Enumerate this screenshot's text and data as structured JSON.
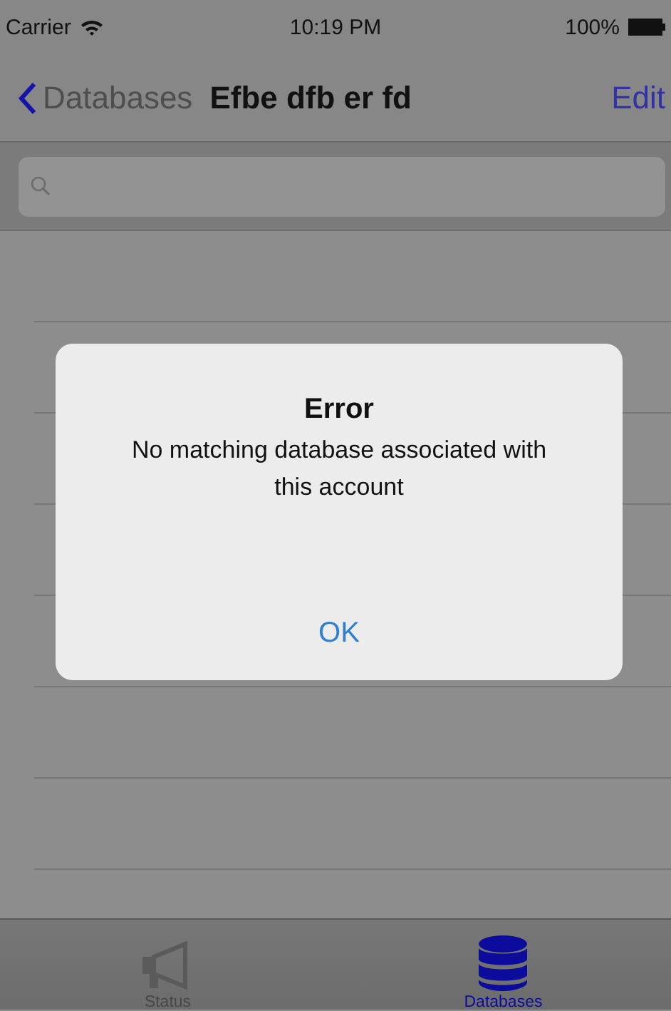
{
  "status_bar": {
    "carrier": "Carrier",
    "time": "10:19 PM",
    "battery": "100%"
  },
  "nav_bar": {
    "back": "Databases",
    "title": "Efbe dfb er fd",
    "action": "Edit"
  },
  "alert": {
    "title": "Error",
    "message": "No matching database associated with this account",
    "buttons": [
      "OK"
    ]
  },
  "tab_bar": {
    "tabs": [
      {
        "label": "Status",
        "kind": "megaphone",
        "selected": false
      },
      {
        "label": "Databases",
        "kind": "database",
        "selected": true
      }
    ]
  }
}
